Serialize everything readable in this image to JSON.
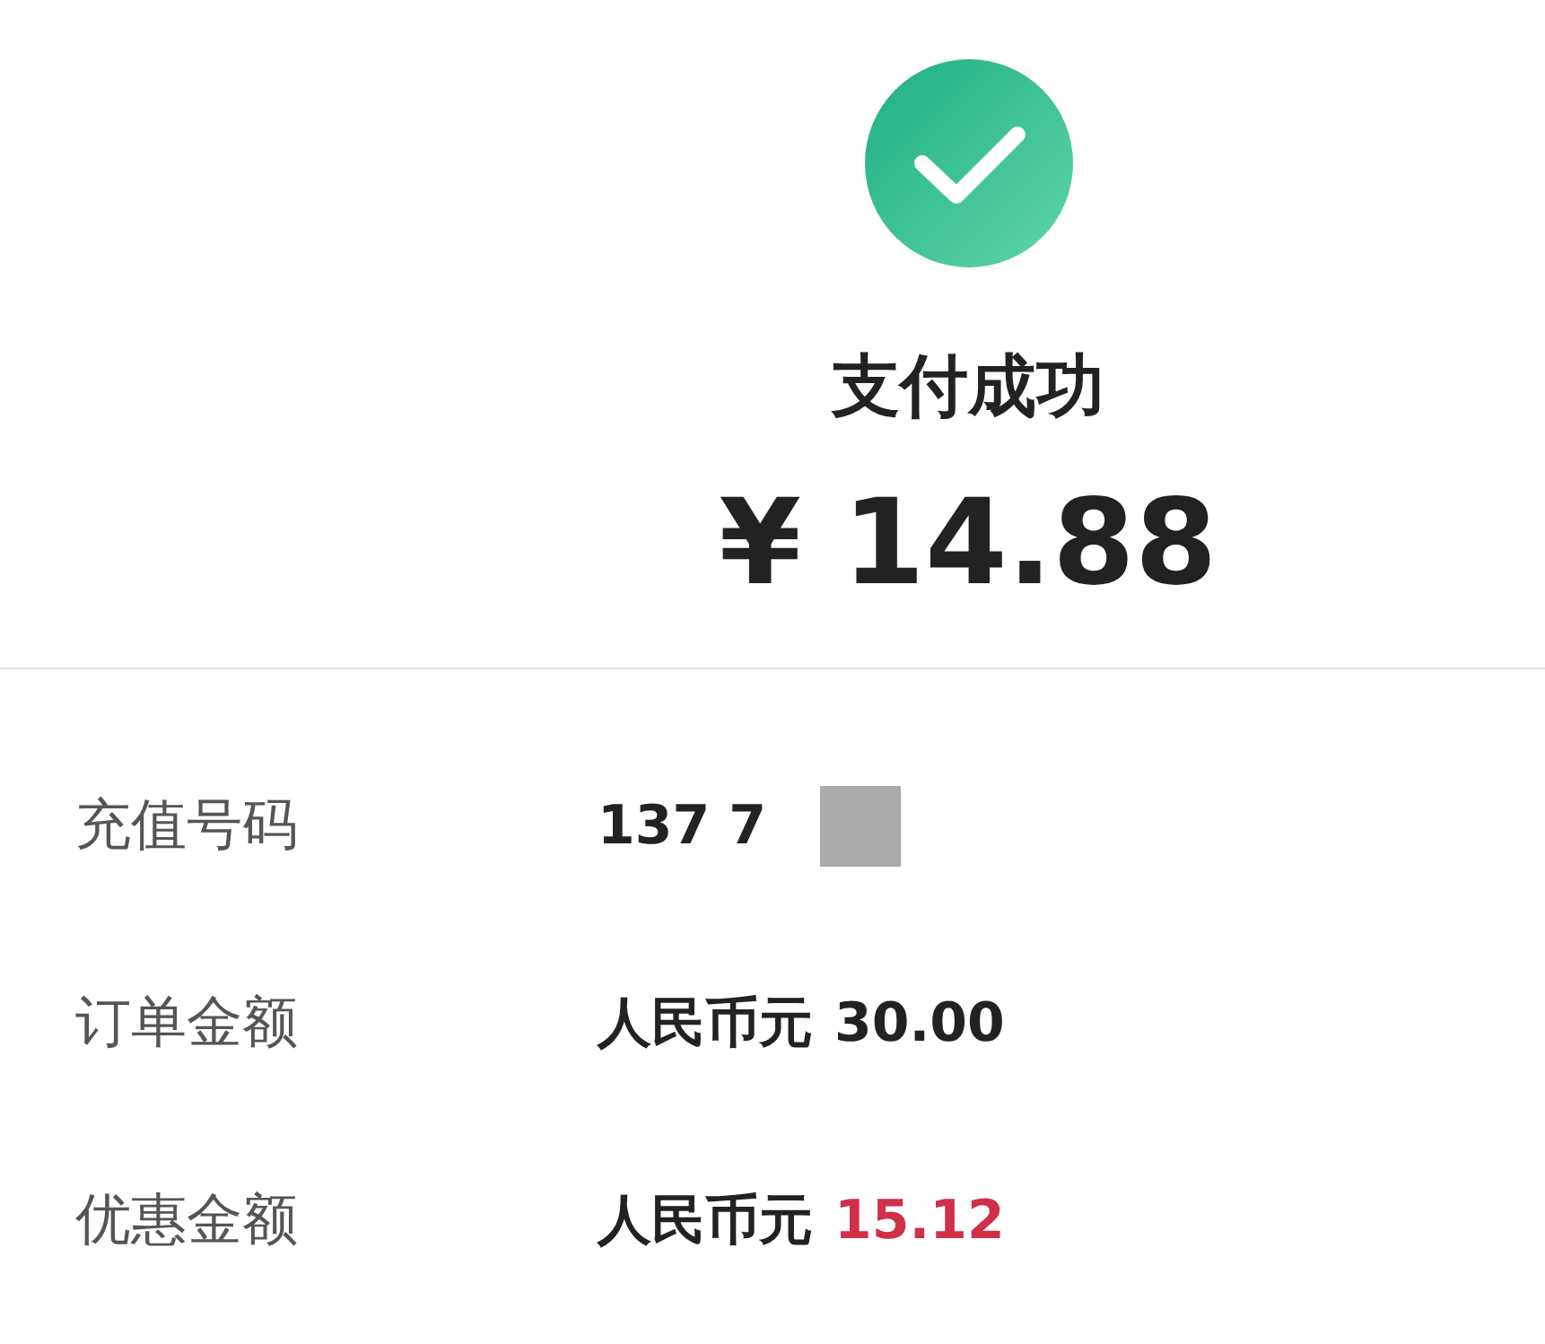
{
  "status": {
    "title": "支付成功",
    "amount": "¥ 14.88"
  },
  "details": [
    {
      "label": "充值号码",
      "value": "137 7",
      "redacted": true
    },
    {
      "label": "订单金额",
      "value": "人民币元",
      "amount": "30.00",
      "color": "#222222"
    },
    {
      "label": "优惠金额",
      "value": "人民币元",
      "amount": "15.12",
      "color": "#d0304a"
    }
  ]
}
